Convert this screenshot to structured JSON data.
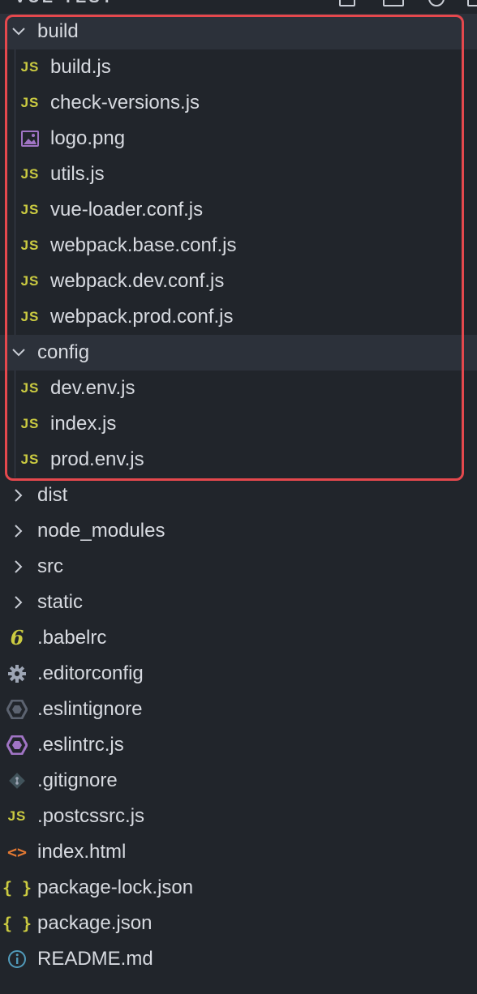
{
  "window": {
    "title": "VUE-TEST"
  },
  "tree": {
    "build": {
      "label": "build",
      "files": [
        "build.js",
        "check-versions.js",
        "logo.png",
        "utils.js",
        "vue-loader.conf.js",
        "webpack.base.conf.js",
        "webpack.dev.conf.js",
        "webpack.prod.conf.js"
      ]
    },
    "config": {
      "label": "config",
      "files": [
        "dev.env.js",
        "index.js",
        "prod.env.js"
      ]
    },
    "collapsed_folders": [
      "dist",
      "node_modules",
      "src",
      "static"
    ],
    "root_files": [
      ".babelrc",
      ".editorconfig",
      ".eslintignore",
      ".eslintrc.js",
      ".gitignore",
      ".postcssrc.js",
      "index.html",
      "package-lock.json",
      "package.json",
      "README.md"
    ]
  },
  "icons": {
    "js_glyph": "JS",
    "json_glyph": "{ }",
    "html_glyph": "<>",
    "babel_glyph": "6"
  },
  "colors": {
    "background": "#21252b",
    "selected_folder": "#2c313a",
    "js_icon": "#cbcb41",
    "html_icon": "#e37933",
    "eslint_icon": "#a074c4",
    "info_icon": "#519aba",
    "highlight_border": "#e5484d"
  }
}
